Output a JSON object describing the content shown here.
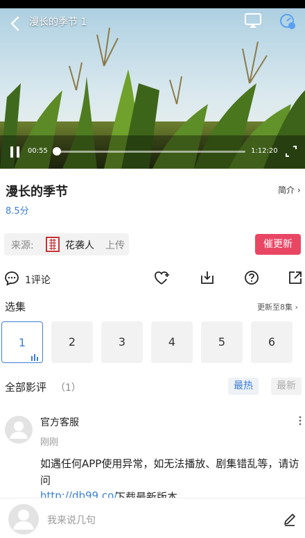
{
  "video": {
    "title": "漫长的季节 1",
    "current_time": "00:55",
    "total_time": "1:12:20",
    "progress_percent": 1.3,
    "icons": [
      "back-icon",
      "cast-icon",
      "speed-icon",
      "pause-icon",
      "fullscreen-icon"
    ]
  },
  "info": {
    "title": "漫长的季节",
    "intro_link": "简介 ›",
    "rating": "8.5分",
    "source_label": "来源:",
    "uploader_name": "花袭人",
    "uploader_suffix": "上传",
    "update_button": "催更新"
  },
  "actions": {
    "comment_count": "1评论",
    "icons": [
      "comment-icon",
      "like-icon",
      "download-icon",
      "help-icon",
      "share-icon"
    ]
  },
  "episodes": {
    "heading": "选集",
    "more": "更新至8集 ›",
    "items": [
      "1",
      "2",
      "3",
      "4",
      "5",
      "6"
    ],
    "active_index": 0
  },
  "reviews": {
    "heading": "全部影评",
    "count": "（1）",
    "tab_hot": "最热",
    "tab_new": "最新",
    "comment": {
      "author": "官方客服",
      "time": "刚刚",
      "text": "如遇任何APP使用异常，如无法播放、剧集错乱等，请访问",
      "link": "http://db99.co/",
      "tail": " 下载最新版本"
    }
  },
  "input": {
    "placeholder": "我来说几句"
  },
  "colors": {
    "accent": "#3a7fd5",
    "update_button": "#e94664"
  }
}
